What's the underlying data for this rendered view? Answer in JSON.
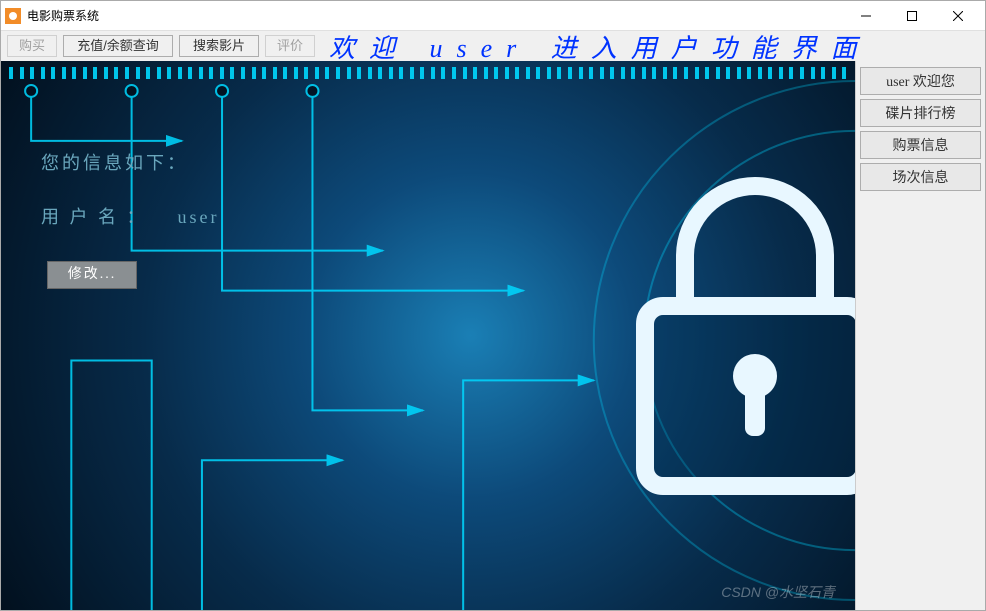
{
  "window": {
    "title": "电影购票系统"
  },
  "toolbar": {
    "buy_label": "购买",
    "recharge_label": "充值/余额查询",
    "search_label": "搜索影片",
    "review_label": "评价"
  },
  "banner": {
    "text": "欢迎 user 进入用户功能界面"
  },
  "info": {
    "heading": "您的信息如下：",
    "username_label": "用 户 名 ：",
    "username_value": "user",
    "modify_label": "修改..."
  },
  "sidebar": {
    "items": [
      {
        "label": "user 欢迎您"
      },
      {
        "label": "碟片排行榜"
      },
      {
        "label": "购票信息"
      },
      {
        "label": "场次信息"
      }
    ]
  },
  "watermark": "CSDN @水坚石青",
  "colors": {
    "accent": "#00d8ff",
    "banner_text": "#0033ff"
  }
}
